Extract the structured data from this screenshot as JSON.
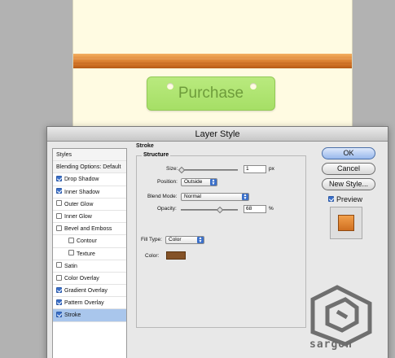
{
  "canvas": {
    "button_label": "Purchase"
  },
  "dialog": {
    "title": "Layer Style",
    "styles_list": [
      {
        "label": "Styles",
        "type": "header"
      },
      {
        "label": "Blending Options: Default",
        "type": "header"
      },
      {
        "label": "Drop Shadow",
        "checked": true
      },
      {
        "label": "Inner Shadow",
        "checked": true
      },
      {
        "label": "Outer Glow",
        "checked": false
      },
      {
        "label": "Inner Glow",
        "checked": false
      },
      {
        "label": "Bevel and Emboss",
        "checked": false
      },
      {
        "label": "Contour",
        "checked": false,
        "indent": true
      },
      {
        "label": "Texture",
        "checked": false,
        "indent": true
      },
      {
        "label": "Satin",
        "checked": false
      },
      {
        "label": "Color Overlay",
        "checked": false
      },
      {
        "label": "Gradient Overlay",
        "checked": true
      },
      {
        "label": "Pattern Overlay",
        "checked": true
      },
      {
        "label": "Stroke",
        "checked": true,
        "selected": true
      }
    ],
    "stroke": {
      "section_title": "Stroke",
      "structure_title": "Structure",
      "size_label": "Size:",
      "size_value": "1",
      "size_unit": "px",
      "position_label": "Position:",
      "position_value": "Outside",
      "blend_mode_label": "Blend Mode:",
      "blend_mode_value": "Normal",
      "opacity_label": "Opacity:",
      "opacity_value": "68",
      "opacity_unit": "%",
      "fill_type_label": "Fill Type:",
      "fill_type_value": "Color",
      "color_label": "Color:",
      "color_hex": "#845227"
    },
    "buttons": {
      "ok": "OK",
      "cancel": "Cancel",
      "new_style": "New Style...",
      "preview": "Preview"
    }
  },
  "watermark": {
    "text": "sargon"
  }
}
